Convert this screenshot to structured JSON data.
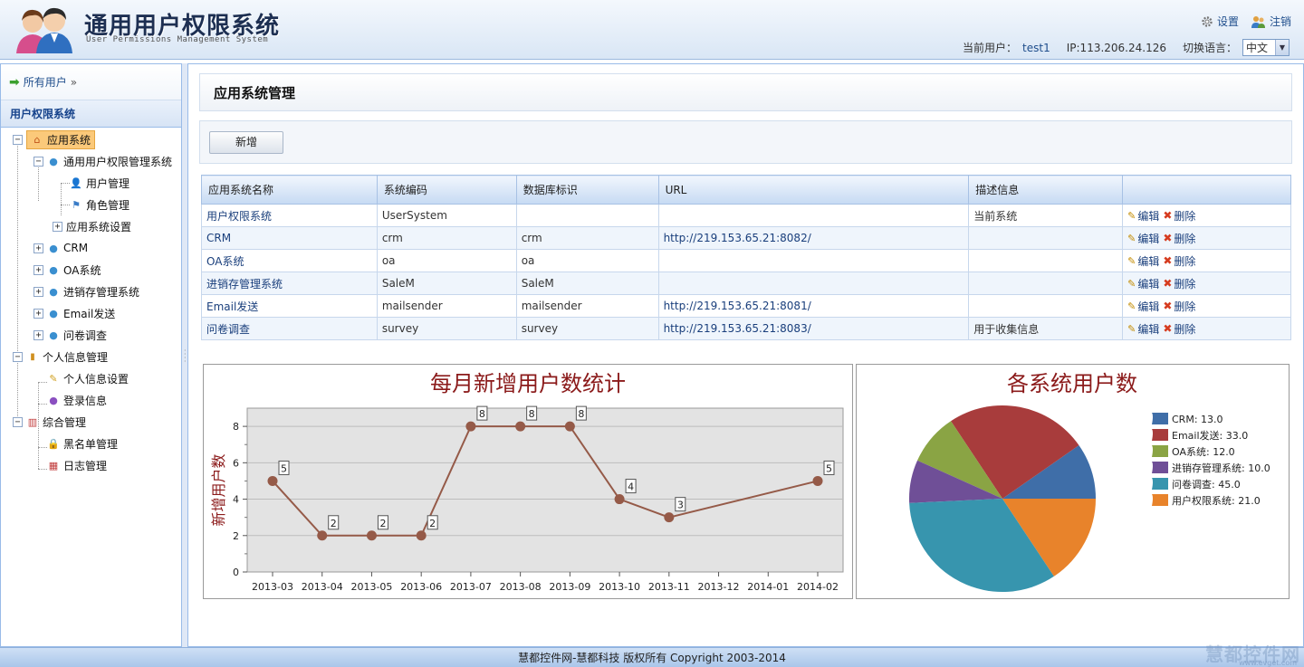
{
  "header": {
    "title": "通用用户权限系统",
    "subtitle": "User Permissions Management System",
    "settings_label": "设置",
    "logout_label": "注销",
    "current_user_label": "当前用户：",
    "current_user": "test1",
    "ip_text": "IP:113.206.24.126",
    "language_label": "切换语言：",
    "language_value": "中文"
  },
  "sidebar": {
    "breadcrumb": "所有用户",
    "breadcrumb_suffix": "»",
    "system_title": "用户权限系统",
    "tree": {
      "app_system": "应用系统",
      "umps": "通用用户权限管理系统",
      "user_mgmt": "用户管理",
      "role_mgmt": "角色管理",
      "app_settings": "应用系统设置",
      "crm": "CRM",
      "oa": "OA系统",
      "inventory": "进销存管理系统",
      "email": "Email发送",
      "survey": "问卷调查",
      "personal": "个人信息管理",
      "personal_settings": "个人信息设置",
      "login_info": "登录信息",
      "general": "综合管理",
      "blacklist": "黑名单管理",
      "logs": "日志管理"
    }
  },
  "main": {
    "title": "应用系统管理",
    "add_button": "新增",
    "columns": [
      "应用系统名称",
      "系统编码",
      "数据库标识",
      "URL",
      "描述信息",
      ""
    ],
    "rows": [
      {
        "name": "用户权限系统",
        "code": "UserSystem",
        "db": "",
        "url": "",
        "desc": "当前系统"
      },
      {
        "name": "CRM",
        "code": "crm",
        "db": "crm",
        "url": "http://219.153.65.21:8082/",
        "desc": ""
      },
      {
        "name": "OA系统",
        "code": "oa",
        "db": "oa",
        "url": "",
        "desc": ""
      },
      {
        "name": "进销存管理系统",
        "code": "SaleM",
        "db": "SaleM",
        "url": "",
        "desc": ""
      },
      {
        "name": "Email发送",
        "code": "mailsender",
        "db": "mailsender",
        "url": "http://219.153.65.21:8081/",
        "desc": ""
      },
      {
        "name": "问卷调查",
        "code": "survey",
        "db": "survey",
        "url": "http://219.153.65.21:8083/",
        "desc": "用于收集信息"
      }
    ],
    "edit_label": "编辑",
    "delete_label": "删除"
  },
  "chart_data": [
    {
      "type": "line",
      "title": "每月新增用户数统计",
      "xlabel": "",
      "ylabel": "新增用户数",
      "categories": [
        "2013-03",
        "2013-04",
        "2013-05",
        "2013-06",
        "2013-07",
        "2013-08",
        "2013-09",
        "2013-10",
        "2013-11",
        "2013-12",
        "2014-01",
        "2014-02"
      ],
      "series": [
        {
          "values": [
            5,
            2,
            2,
            2,
            8,
            8,
            8,
            4,
            3,
            null,
            null,
            5
          ]
        }
      ],
      "ylim": [
        0,
        9
      ],
      "yticks": [
        0,
        2,
        4,
        6,
        8
      ],
      "grid": true,
      "line_color": "#955a48",
      "plot_background": "#e3e3e3"
    },
    {
      "type": "pie",
      "title": "各系统用户数",
      "legend_position": "right",
      "slices": [
        {
          "label": "CRM",
          "value": 13.0,
          "legend": "CRM: 13.0",
          "color": "#3f6ea8"
        },
        {
          "label": "Email发送",
          "value": 33.0,
          "legend": "Email发送: 33.0",
          "color": "#a83c3c"
        },
        {
          "label": "OA系统",
          "value": 12.0,
          "legend": "OA系统: 12.0",
          "color": "#8aa444"
        },
        {
          "label": "进销存管理系统",
          "value": 10.0,
          "legend": "进销存管理系统: 10.0",
          "color": "#6f4f97"
        },
        {
          "label": "问卷调查",
          "value": 45.0,
          "legend": "问卷调查: 45.0",
          "color": "#3795ae"
        },
        {
          "label": "用户权限系统",
          "value": 21.0,
          "legend": "用户权限系统: 21.0",
          "color": "#e8832b"
        }
      ]
    }
  ],
  "footer": {
    "copyright": "慧都控件网-慧都科技 版权所有 Copyright 2003-2014",
    "watermark": "慧都控件网",
    "watermark_url": "www.evget.com"
  }
}
